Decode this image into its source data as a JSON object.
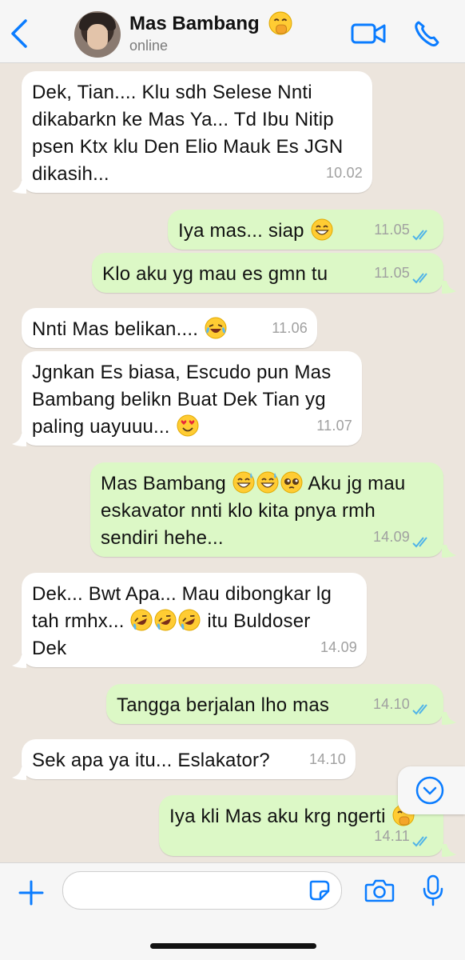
{
  "header": {
    "back_icon": "chevron-left-icon",
    "contact_name": "Mas Bambang",
    "contact_emoji": "face-with-hand-over-mouth",
    "status": "online",
    "video_icon": "video-camera-icon",
    "call_icon": "phone-icon"
  },
  "messages": [
    {
      "dir": "in",
      "lines": [
        "Dek, Tian.... Klu sdh Selese Nnti",
        "dikabarkn ke Mas Ya... Td Ibu Nitip",
        "psen Ktx klu Den Elio Mauk Es JGN",
        "dikasih..."
      ],
      "time": "10.02"
    },
    {
      "dir": "out",
      "text": "Iya mas... siap",
      "emoji": [
        "grinning-smiling-eyes"
      ],
      "time": "11.05",
      "read": true
    },
    {
      "dir": "out",
      "text": "Klo aku yg mau es gmn tu",
      "time": "11.05",
      "read": true
    },
    {
      "dir": "in",
      "text": "Nnti Mas belikan....",
      "emoji": [
        "face-with-tears-of-joy"
      ],
      "time": "11.06"
    },
    {
      "dir": "in",
      "lines": [
        "Jgnkan Es biasa, Escudo pun Mas",
        "Bambang belikn Buat Dek Tian yg",
        "paling uayuuu..."
      ],
      "emoji": [
        "smiling-heart-eyes"
      ],
      "time": "11.07"
    },
    {
      "dir": "out",
      "lines": [
        "Mas Bambang",
        "Aku jg mau",
        "eskavator nnti klo kita pnya rmh",
        "sendiri hehe..."
      ],
      "emoji": [
        "grinning-sweat",
        "grinning-sweat",
        "pleading-face"
      ],
      "time": "14.09",
      "read": true
    },
    {
      "dir": "in",
      "lines": [
        "Dek... Bwt Apa... Mau dibongkar lg",
        "tah rmhx...",
        "itu Buldoser",
        "Dek"
      ],
      "emoji": [
        "rolling-on-floor-laughing",
        "rolling-on-floor-laughing",
        "rolling-on-floor-laughing"
      ],
      "time": "14.09"
    },
    {
      "dir": "out",
      "text": "Tangga berjalan lho mas",
      "time": "14.10",
      "read": true
    },
    {
      "dir": "in",
      "text": "Sek apa ya itu... Eslakator?",
      "time": "14.10"
    },
    {
      "dir": "out",
      "text": "Iya kli Mas aku krg ngerti",
      "emoji": [
        "face-with-hand-over-mouth"
      ],
      "time": "14.11",
      "read": true
    }
  ],
  "scroll_icon": "chevron-down-circle-icon",
  "footer": {
    "plus_icon": "plus-icon",
    "input_value": "",
    "sticker_icon": "sticker-icon",
    "camera_icon": "camera-icon",
    "mic_icon": "microphone-icon"
  },
  "colors": {
    "chat_bg": "#ece5dd",
    "incoming_bubble": "#ffffff",
    "outgoing_bubble": "#dcf8c6",
    "accent": "#0a7cff",
    "read_ticks": "#4fb3e8"
  }
}
